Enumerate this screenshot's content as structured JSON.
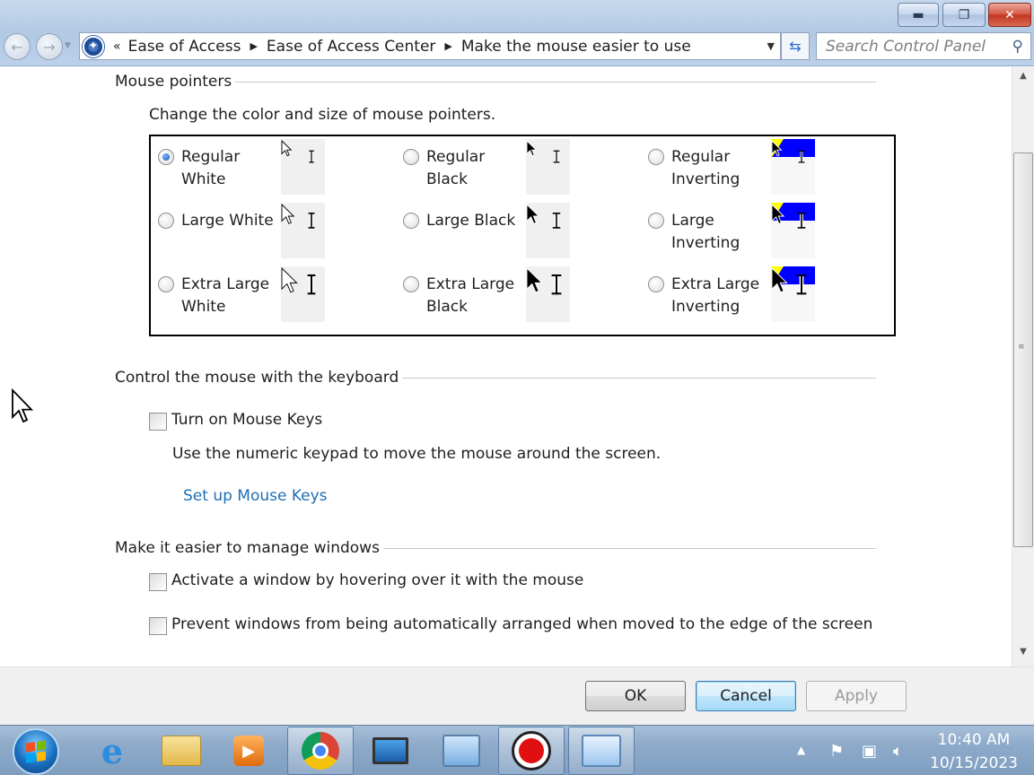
{
  "window": {
    "minimize_icon": "minimize-icon",
    "maximize_icon": "restore-icon",
    "close_icon": "close-icon"
  },
  "nav": {
    "breadcrumbs": [
      "Ease of Access",
      "Ease of Access Center",
      "Make the mouse easier to use"
    ],
    "search_placeholder": "Search Control Panel"
  },
  "sections": {
    "pointers": {
      "heading": "Mouse pointers",
      "description": "Change the color and size of mouse pointers.",
      "selected": "Regular White",
      "options": [
        {
          "label": "Regular White",
          "scheme": "white",
          "size": "regular"
        },
        {
          "label": "Regular Black",
          "scheme": "black",
          "size": "regular"
        },
        {
          "label": "Regular Inverting",
          "scheme": "inverting",
          "size": "regular"
        },
        {
          "label": "Large White",
          "scheme": "white",
          "size": "large"
        },
        {
          "label": "Large Black",
          "scheme": "black",
          "size": "large"
        },
        {
          "label": "Large Inverting",
          "scheme": "inverting",
          "size": "large"
        },
        {
          "label": "Extra Large White",
          "scheme": "white",
          "size": "xlarge"
        },
        {
          "label": "Extra Large Black",
          "scheme": "black",
          "size": "xlarge"
        },
        {
          "label": "Extra Large Inverting",
          "scheme": "inverting",
          "size": "xlarge"
        }
      ]
    },
    "keyboard": {
      "heading": "Control the mouse with the keyboard",
      "mouse_keys_label": "Turn on Mouse Keys",
      "mouse_keys_checked": false,
      "mouse_keys_desc": "Use the numeric keypad to move the mouse around the screen.",
      "setup_link": "Set up Mouse Keys"
    },
    "windows": {
      "heading": "Make it easier to manage windows",
      "hover_label": "Activate a window by hovering over it with the mouse",
      "hover_checked": false,
      "arrange_label": "Prevent windows from being automatically arranged when moved to the edge of the screen",
      "arrange_checked": false
    }
  },
  "buttons": {
    "ok": "OK",
    "cancel": "Cancel",
    "apply": "Apply"
  },
  "taskbar": {
    "items": [
      "start-orb",
      "internet-explorer-icon",
      "file-explorer-icon",
      "media-player-icon",
      "chrome-icon",
      "remote-desktop-icon",
      "on-screen-keyboard-icon",
      "recorder-icon",
      "control-panel-icon"
    ],
    "time": "10:40 AM",
    "date": "10/15/2023"
  },
  "colors": {
    "link": "#1f6fb6",
    "inverting_blue": "#0000ff",
    "inverting_yellow": "#ffff00"
  }
}
